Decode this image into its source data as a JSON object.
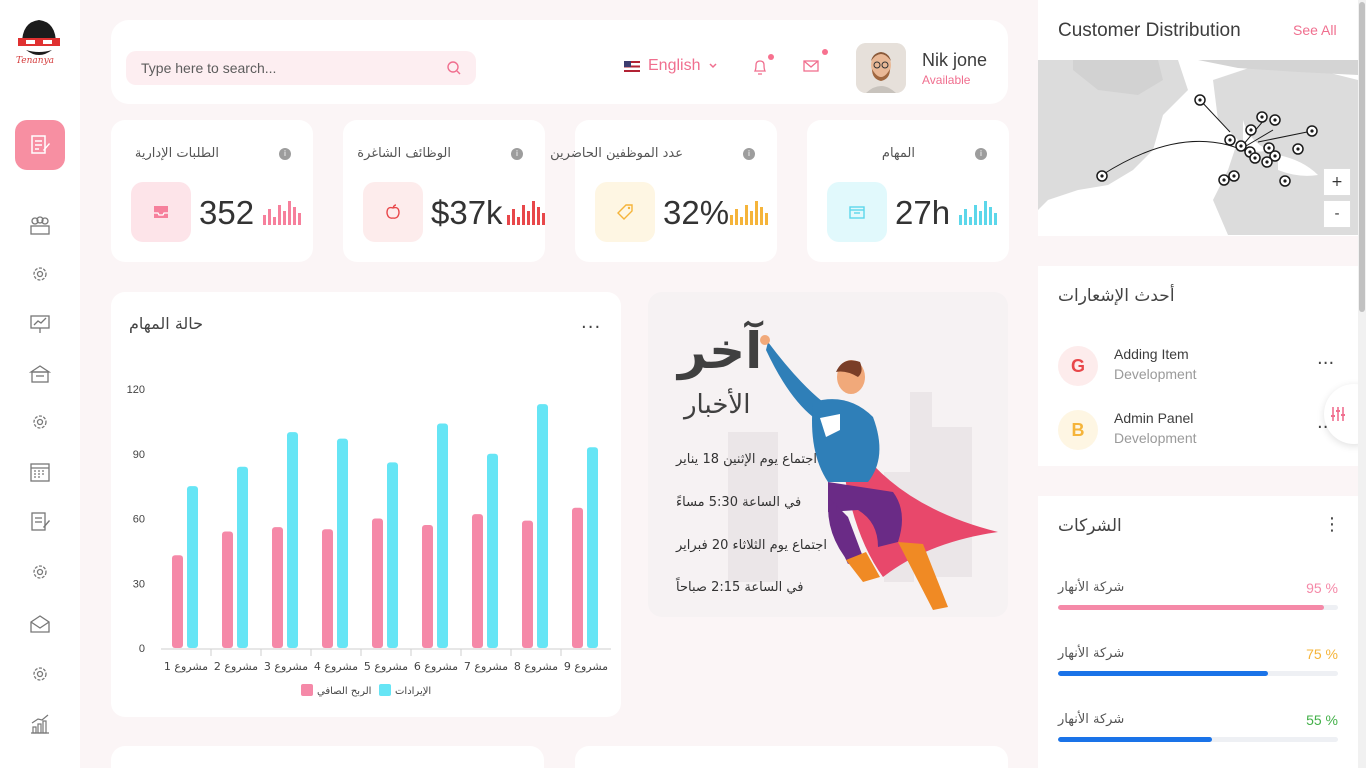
{
  "brand": {
    "logo_text": "Tenanya"
  },
  "sidebar": {
    "items": [
      {
        "icon": "document-edit-icon"
      },
      {
        "icon": "team-icon"
      },
      {
        "icon": "settings-gear-icon"
      },
      {
        "icon": "presentation-chart-icon"
      },
      {
        "icon": "store-icon"
      },
      {
        "icon": "settings-gear-icon"
      },
      {
        "icon": "calendar-icon"
      },
      {
        "icon": "document-edit-icon"
      },
      {
        "icon": "settings-gear-icon"
      },
      {
        "icon": "mail-open-icon"
      },
      {
        "icon": "settings-gear-icon"
      },
      {
        "icon": "growth-chart-icon"
      }
    ]
  },
  "header": {
    "search_placeholder": "Type here to search...",
    "language": "English",
    "user_name": "Nik jone",
    "user_status": "Available"
  },
  "stats": [
    {
      "title": "الطلبات الإدارية",
      "value": "352",
      "color": "#f6809c",
      "bg": "#fde4e9"
    },
    {
      "title": "الوظائف الشاغرة",
      "value": "$37k",
      "color": "#e8474a",
      "bg": "#fdecec"
    },
    {
      "title": "عدد الموظفين الحاضرين",
      "value": "32%",
      "color": "#f5b43a",
      "bg": "#fef6e3"
    },
    {
      "title": "المهام",
      "value": "27h",
      "color": "#5cd7ea",
      "bg": "#e1f9fc"
    }
  ],
  "task_chart": {
    "title": "حالة المهام",
    "menu": "..."
  },
  "chart_data": {
    "type": "bar",
    "categories": [
      "مشروع 1",
      "مشروع 2",
      "مشروع 3",
      "مشروع 4",
      "مشروع 5",
      "مشروع 6",
      "مشروع 7",
      "مشروع 8",
      "مشروع 9"
    ],
    "series": [
      {
        "name": "الربح الصافي",
        "color": "#f589a8",
        "values": [
          43,
          54,
          56,
          55,
          60,
          57,
          62,
          59,
          65
        ]
      },
      {
        "name": "الإيرادات",
        "color": "#66e5f5",
        "values": [
          75,
          84,
          100,
          97,
          86,
          104,
          90,
          113,
          93
        ]
      }
    ],
    "ylim": [
      0,
      120
    ],
    "yticks": [
      0,
      30,
      60,
      90,
      120
    ],
    "grid": false,
    "legend_position": "bottom"
  },
  "news": {
    "title_big": "آخر",
    "title_sub": "الأخبار",
    "lines": [
      "اجتماع يوم الإثنين 18 يناير",
      "في الساعة 5:30 مساءً",
      "اجتماع يوم الثلاثاء 20 فبراير",
      "في الساعة 2:15 صباحاً"
    ]
  },
  "customer_distribution": {
    "title": "Customer Distribution",
    "see_all": "See All",
    "zoom_in": "+",
    "zoom_out": "-"
  },
  "notifications": {
    "title": "أحدث الإشعارات",
    "items": [
      {
        "badge": "G",
        "name": "Adding Item",
        "sub": "Development",
        "color": "#e8474a",
        "bg": "#fdecec"
      },
      {
        "badge": "B",
        "name": "Admin Panel",
        "sub": "Development",
        "color": "#f5b43a",
        "bg": "#fef6e3"
      }
    ],
    "more": "..."
  },
  "companies": {
    "title": "الشركات",
    "items": [
      {
        "name": "شركة الأنهار",
        "pct": "95 %",
        "value": 0.95,
        "color": "#f589a8",
        "fill": "#f589a8"
      },
      {
        "name": "شركة الأنهار",
        "pct": "75 %",
        "value": 0.75,
        "color": "#f5b43a",
        "fill": "#1a73e8"
      },
      {
        "name": "شركة الأنهار",
        "pct": "55 %",
        "value": 0.55,
        "color": "#43b049",
        "fill": "#1a73e8"
      }
    ]
  }
}
